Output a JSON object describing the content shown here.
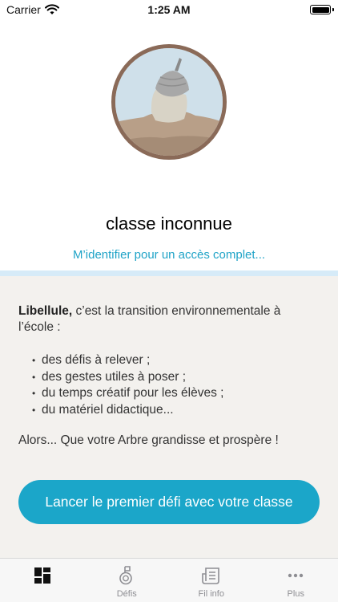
{
  "status_bar": {
    "carrier": "Carrier",
    "time": "1:25 AM"
  },
  "profile": {
    "class_name": "classe inconnue",
    "identify_link": "M’identifier pour un accès complet..."
  },
  "info": {
    "brand": "Libellule,",
    "intro_rest": " c’est la transition environnementale à l’école :",
    "bullets": [
      "des défis à relever ;",
      "des gestes utiles à poser ;",
      "du temps créatif pour les élèves ;",
      "du matériel didactique..."
    ],
    "outro": "Alors... Que votre Arbre grandisse et prospère !"
  },
  "cta": {
    "label": "Lancer le premier défi avec votre classe"
  },
  "tab_bar": {
    "tabs": [
      {
        "icon": "dashboard-icon",
        "label": "",
        "active": true
      },
      {
        "icon": "medal-icon",
        "label": "Défis",
        "active": false
      },
      {
        "icon": "news-icon",
        "label": "Fil info",
        "active": false
      },
      {
        "icon": "more-icon",
        "label": "Plus",
        "active": false
      }
    ]
  },
  "colors": {
    "accent": "#1ba6c9",
    "link": "#1fa3c7",
    "avatar_ring": "#8a6a58",
    "section_bg": "#f3f1ee",
    "divider": "#d6ebf8"
  }
}
